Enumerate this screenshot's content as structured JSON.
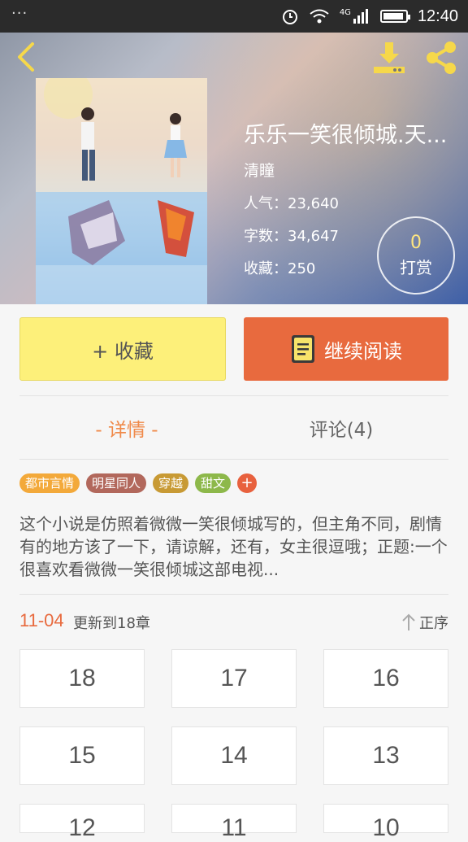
{
  "status_bar": {
    "time": "12:40",
    "network": "4G"
  },
  "header": {
    "back_icon": "chevron-left-icon",
    "download_icon": "download-icon",
    "share_icon": "share-icon"
  },
  "book": {
    "title": "乐乐一笑很倾城.天...",
    "author": "清瞳",
    "popularity_label": "人气：23,640",
    "words_label": "字数：34,647",
    "favorites_label": "收藏：250",
    "reward_count": "0",
    "reward_label": "打赏"
  },
  "actions": {
    "favorite_label": "+ 收藏",
    "read_label": "继续阅读"
  },
  "tabs": [
    {
      "label": "- 详情 -",
      "active": true
    },
    {
      "label": "评论(4)",
      "active": false
    }
  ],
  "tags": [
    {
      "label": "都市言情",
      "color": "#f3a93a"
    },
    {
      "label": "明星同人",
      "color": "#b2685c"
    },
    {
      "label": "穿越",
      "color": "#c89a34"
    },
    {
      "label": "甜文",
      "color": "#8db84a"
    }
  ],
  "tags_more": "+",
  "synopsis": "这个小说是仿照着微微一笑很倾城写的，但主角不同，剧情有的地方该了一下，请谅解，还有，女主很逗哦；正题:一个很喜欢看微微一笑很倾城这部电视...",
  "update": {
    "date": "11-04",
    "text": "更新到18章",
    "sort_label": "正序"
  },
  "chapters": [
    "18",
    "17",
    "16",
    "15",
    "14",
    "13",
    "12",
    "11",
    "10"
  ],
  "colors": {
    "accent_orange": "#e86a3e",
    "favorite_yellow": "#fdf07a"
  }
}
